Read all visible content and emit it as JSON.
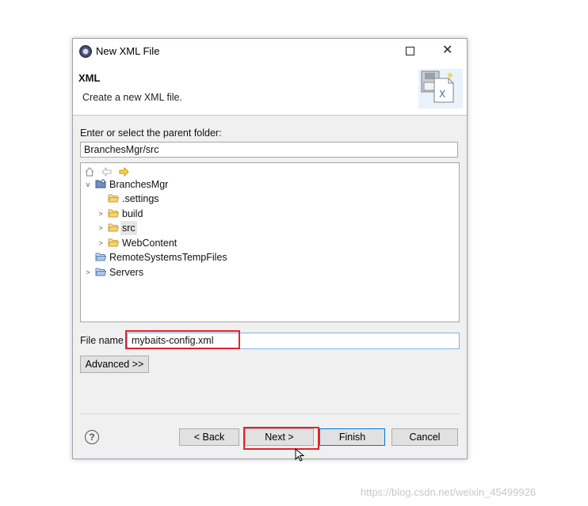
{
  "dialog": {
    "title": "New XML File",
    "header": {
      "title": "XML",
      "description": "Create a new XML file."
    },
    "parent_folder_label": "Enter or select the parent folder:",
    "parent_folder_value": "BranchesMgr/src",
    "tree": [
      {
        "label": "BranchesMgr",
        "twisty": "v",
        "icon": "project-icon"
      },
      {
        "label": ".settings",
        "twisty": "",
        "icon": "folder-icon"
      },
      {
        "label": "build",
        "twisty": ">",
        "icon": "folder-icon"
      },
      {
        "label": "src",
        "twisty": ">",
        "icon": "folder-icon",
        "selected": true
      },
      {
        "label": "WebContent",
        "twisty": ">",
        "icon": "folder-icon"
      },
      {
        "label": "RemoteSystemsTempFiles",
        "twisty": "",
        "icon": "folder-icon"
      },
      {
        "label": "Servers",
        "twisty": ">",
        "icon": "folder-icon"
      }
    ],
    "file_name_label": "File name",
    "file_name_value": "mybaits-config.xml",
    "advanced_label": "Advanced >>",
    "buttons": {
      "back": "< Back",
      "next": "Next >",
      "finish": "Finish",
      "cancel": "Cancel"
    },
    "help_glyph": "?"
  },
  "highlight_color": "#e0232f",
  "watermark": "https://blog.csdn.net/weixin_45499926"
}
